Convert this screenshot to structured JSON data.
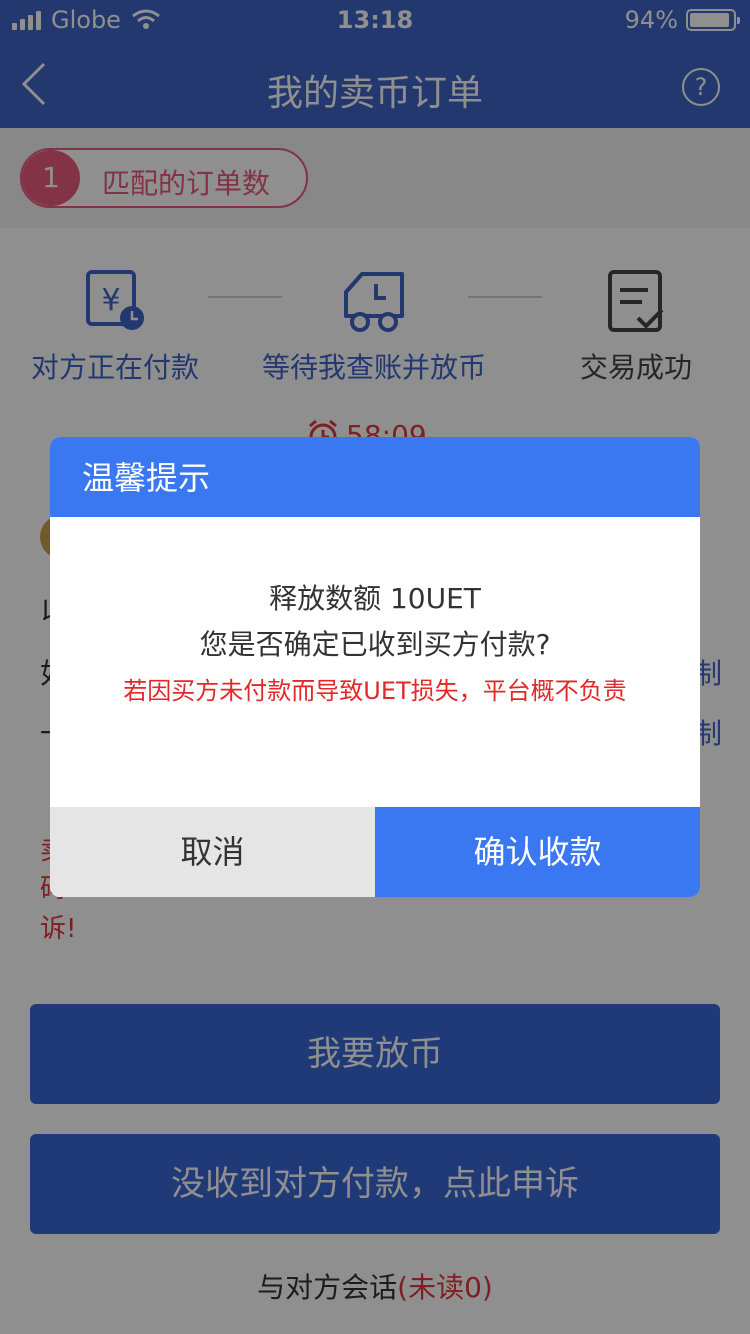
{
  "status_bar": {
    "carrier": "Globe",
    "time": "13:18",
    "battery_percent": "94%",
    "battery_level": 0.94
  },
  "nav": {
    "title": "我的卖币订单",
    "help_symbol": "?"
  },
  "match": {
    "count": "1",
    "label": "匹配的订单数"
  },
  "steps": [
    {
      "label": "对方正在付款",
      "icon": "yen-clock-icon"
    },
    {
      "label": "等待我查账并放币",
      "icon": "truck-clock-icon"
    },
    {
      "label": "交易成功",
      "icon": "checklist-icon"
    }
  ],
  "timer": "58:09",
  "background_fragments": {
    "row1": "以",
    "row2": "如",
    "row3": "一",
    "copy1": "制",
    "copy2": "制",
    "warn1": "卖",
    "warn2": "码",
    "warn3": "诉!"
  },
  "buttons": {
    "release": "我要放币",
    "appeal": "没收到对方付款，点此申诉"
  },
  "chat": {
    "label": "与对方会话",
    "unread": "(未读0)"
  },
  "dialog": {
    "title": "温馨提示",
    "amount": "释放数额 10UET",
    "question": "您是否确定已收到买方付款?",
    "warning": "若因买方未付款而导致UET损失，平台概不负责",
    "cancel": "取消",
    "confirm": "确认收款"
  },
  "colors": {
    "header": "#3f65c6",
    "dialog_accent": "#3a78f2",
    "warning_red": "#e22828",
    "match_pink": "#e85b7d"
  }
}
